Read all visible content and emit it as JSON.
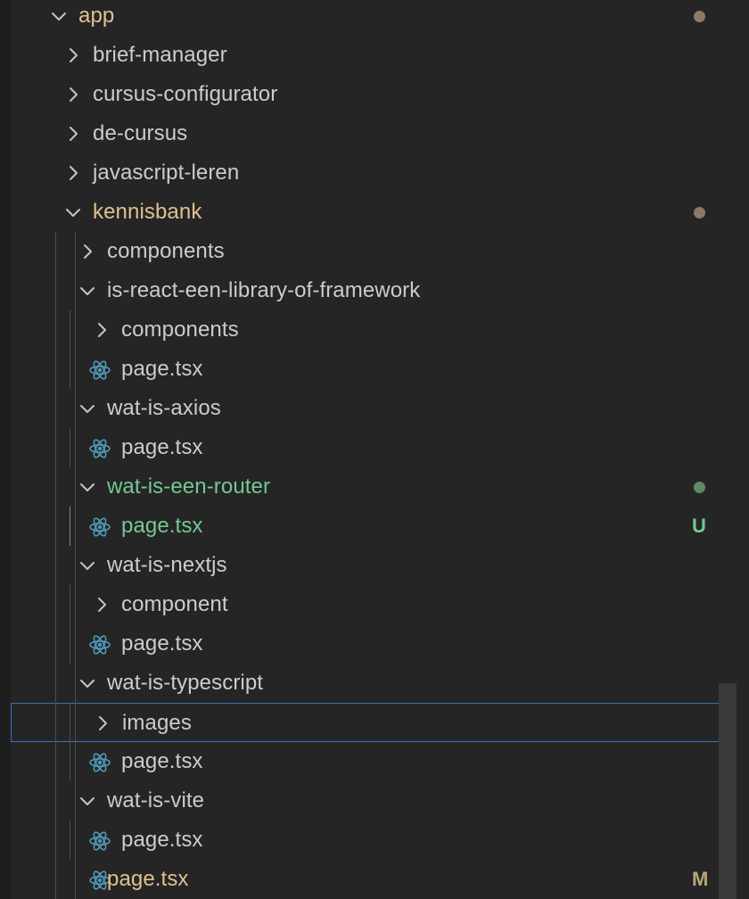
{
  "tree": {
    "rows": [
      {
        "label": "app",
        "kind": "folder",
        "expanded": true,
        "depth": 0,
        "status": "modified",
        "decoration": "dot"
      },
      {
        "label": "brief-manager",
        "kind": "folder",
        "expanded": false,
        "depth": 1
      },
      {
        "label": "cursus-configurator",
        "kind": "folder",
        "expanded": false,
        "depth": 1
      },
      {
        "label": "de-cursus",
        "kind": "folder",
        "expanded": false,
        "depth": 1
      },
      {
        "label": "javascript-leren",
        "kind": "folder",
        "expanded": false,
        "depth": 1
      },
      {
        "label": "kennisbank",
        "kind": "folder",
        "expanded": true,
        "depth": 1,
        "status": "modified",
        "decoration": "dot"
      },
      {
        "label": "components",
        "kind": "folder",
        "expanded": false,
        "depth": 2
      },
      {
        "label": "is-react-een-library-of-framework",
        "kind": "folder",
        "expanded": true,
        "depth": 2
      },
      {
        "label": "components",
        "kind": "folder",
        "expanded": false,
        "depth": 3
      },
      {
        "label": "page.tsx",
        "kind": "file",
        "icon": "react-icon",
        "depth": 3
      },
      {
        "label": "wat-is-axios",
        "kind": "folder",
        "expanded": true,
        "depth": 2
      },
      {
        "label": "page.tsx",
        "kind": "file",
        "icon": "react-icon",
        "depth": 3
      },
      {
        "label": "wat-is-een-router",
        "kind": "folder",
        "expanded": true,
        "depth": 2,
        "status": "untracked",
        "decoration": "dot"
      },
      {
        "label": "page.tsx",
        "kind": "file",
        "icon": "react-icon",
        "depth": 3,
        "status": "untracked",
        "badge": "U"
      },
      {
        "label": "wat-is-nextjs",
        "kind": "folder",
        "expanded": true,
        "depth": 2
      },
      {
        "label": "component",
        "kind": "folder",
        "expanded": false,
        "depth": 3
      },
      {
        "label": "page.tsx",
        "kind": "file",
        "icon": "react-icon",
        "depth": 3
      },
      {
        "label": "wat-is-typescript",
        "kind": "folder",
        "expanded": true,
        "depth": 2
      },
      {
        "label": "images",
        "kind": "folder",
        "expanded": false,
        "depth": 3,
        "focused": true
      },
      {
        "label": "page.tsx",
        "kind": "file",
        "icon": "react-icon",
        "depth": 3
      },
      {
        "label": "wat-is-vite",
        "kind": "folder",
        "expanded": true,
        "depth": 2
      },
      {
        "label": "page.tsx",
        "kind": "file",
        "icon": "react-icon",
        "depth": 3
      },
      {
        "label": "page.tsx",
        "kind": "file",
        "icon": "react-icon",
        "depth": 2,
        "status": "modified",
        "badge": "M"
      }
    ]
  },
  "colors": {
    "background": "#252526",
    "text": "#cccccc",
    "modified": "#e2c08d",
    "untracked": "#73c991",
    "react_icon": "#519aba",
    "focus_border": "#3e73b8"
  }
}
